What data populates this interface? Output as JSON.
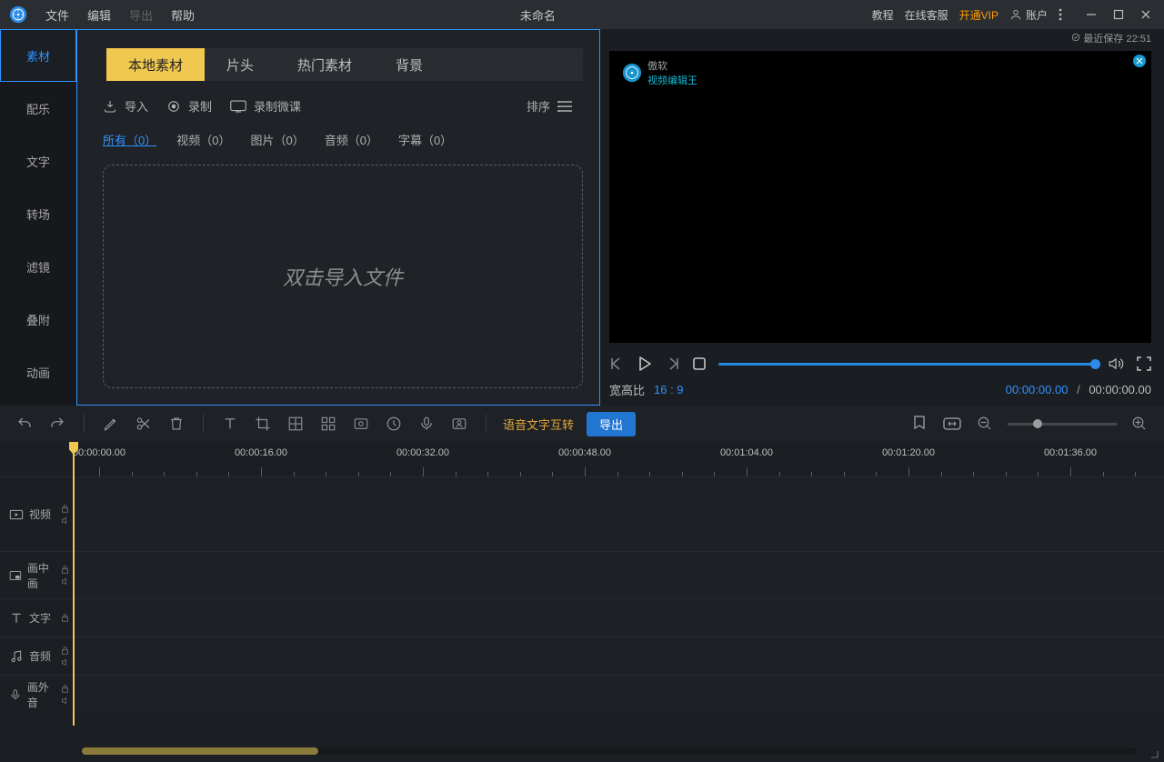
{
  "menu": {
    "file": "文件",
    "edit": "编辑",
    "export": "导出",
    "help": "帮助"
  },
  "title": "未命名",
  "top_links": {
    "tutorial": "教程",
    "service": "在线客服",
    "vip": "开通VIP",
    "account": "账户"
  },
  "last_save": "最近保存 22:51",
  "sidebar": [
    "素材",
    "配乐",
    "文字",
    "转场",
    "滤镜",
    "叠附",
    "动画"
  ],
  "media_tabs": [
    "本地素材",
    "片头",
    "热门素材",
    "背景"
  ],
  "actions": {
    "import": "导入",
    "record": "录制",
    "record_course": "录制微课",
    "sort": "排序"
  },
  "filters": [
    "所有（0）",
    "视频（0）",
    "图片（0）",
    "音频（0）",
    "字幕（0）"
  ],
  "dropzone": "双击导入文件",
  "watermark": {
    "l1": "傲软",
    "l2": "视频编辑王"
  },
  "ratio_label": "宽高比",
  "ratio_value": "16 : 9",
  "time_cur": "00:00:00.00",
  "time_tot": "00:00:00.00",
  "toolbar": {
    "voice": "语音文字互转",
    "export": "导出"
  },
  "ruler": [
    "00:00:00.00",
    "00:00:16.00",
    "00:00:32.00",
    "00:00:48.00",
    "00:01:04.00",
    "00:01:20.00",
    "00:01:36.00"
  ],
  "tracks": {
    "video": "视频",
    "pip": "画中画",
    "text": "文字",
    "audio": "音频",
    "voice": "画外音"
  }
}
